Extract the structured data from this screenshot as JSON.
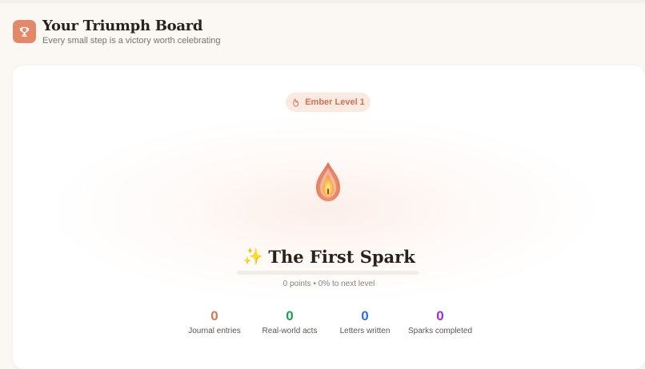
{
  "header": {
    "title": "Your Triumph Board",
    "subtitle": "Every small step is a victory worth celebrating",
    "icon": "trophy-icon"
  },
  "level": {
    "label": "Ember Level 1",
    "icon": "flame-icon"
  },
  "rank": {
    "emoji": "✨",
    "title": "The First Spark",
    "progress_percent": 0,
    "points_text": "0 points • 0% to next level"
  },
  "stats": [
    {
      "value": "0",
      "label": "Journal entries",
      "color": "#d2794f"
    },
    {
      "value": "0",
      "label": "Real-world acts",
      "color": "#1f9d4f"
    },
    {
      "value": "0",
      "label": "Letters written",
      "color": "#2f6fdc"
    },
    {
      "value": "0",
      "label": "Sparks completed",
      "color": "#9b2fd6"
    }
  ],
  "colors": {
    "accent": "#e3896a",
    "pill_bg": "#fbeae2",
    "pill_text": "#cf7352"
  }
}
